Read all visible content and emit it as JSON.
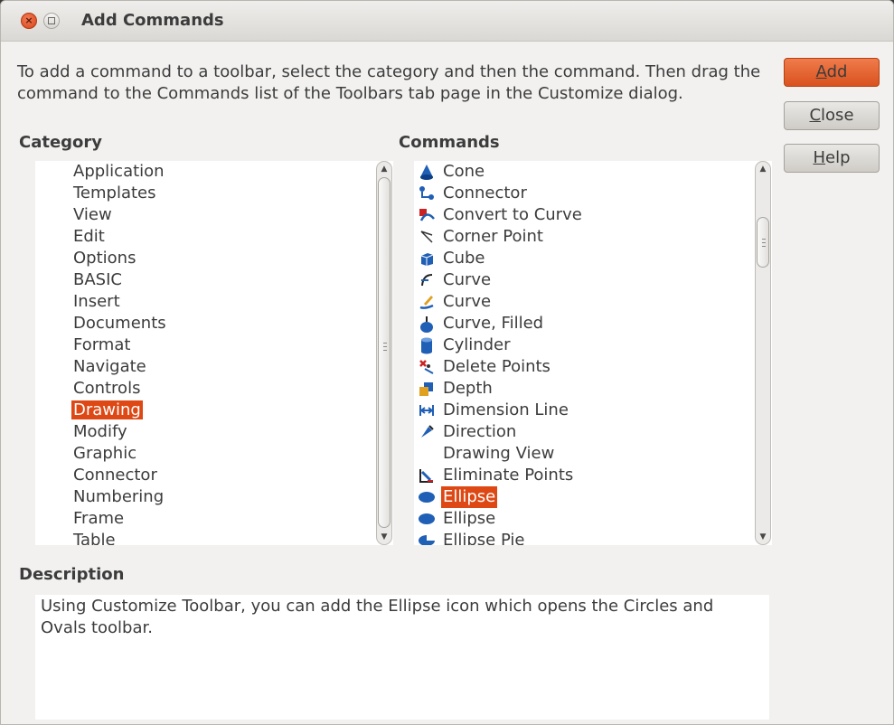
{
  "window": {
    "title": "Add Commands"
  },
  "intro": "To add a command to a toolbar, select the category and then the command. Then drag the command to the Commands list of the Toolbars tab page in the Customize dialog.",
  "buttons": {
    "add": {
      "label": "Add",
      "mnemonic": "A",
      "rest": "dd"
    },
    "close": {
      "label": "Close",
      "mnemonic": "C",
      "rest": "lose"
    },
    "help": {
      "label": "Help",
      "mnemonic": "H",
      "rest": "elp"
    }
  },
  "category": {
    "label": "Category",
    "items": [
      "Application",
      "Templates",
      "View",
      "Edit",
      "Options",
      "BASIC",
      "Insert",
      "Documents",
      "Format",
      "Navigate",
      "Controls",
      "Drawing",
      "Modify",
      "Graphic",
      "Connector",
      "Numbering",
      "Frame",
      "Table"
    ],
    "selected": "Drawing"
  },
  "commands": {
    "label": "Commands",
    "items": [
      {
        "label": "Cone",
        "icon": "cone-icon"
      },
      {
        "label": "Connector",
        "icon": "connector-icon"
      },
      {
        "label": "Convert to Curve",
        "icon": "convert-to-curve-icon"
      },
      {
        "label": "Corner Point",
        "icon": "corner-point-icon"
      },
      {
        "label": "Cube",
        "icon": "cube-icon"
      },
      {
        "label": "Curve",
        "icon": "curve-icon"
      },
      {
        "label": "Curve",
        "icon": "freeform-curve-icon"
      },
      {
        "label": "Curve, Filled",
        "icon": "curve-filled-icon"
      },
      {
        "label": "Cylinder",
        "icon": "cylinder-icon"
      },
      {
        "label": "Delete Points",
        "icon": "delete-points-icon"
      },
      {
        "label": "Depth",
        "icon": "depth-icon"
      },
      {
        "label": "Dimension Line",
        "icon": "dimension-line-icon"
      },
      {
        "label": "Direction",
        "icon": "direction-icon"
      },
      {
        "label": "Drawing View",
        "icon": ""
      },
      {
        "label": "Eliminate Points",
        "icon": "eliminate-points-icon"
      },
      {
        "label": "Ellipse",
        "icon": "ellipse-icon"
      },
      {
        "label": "Ellipse",
        "icon": "ellipse-icon"
      },
      {
        "label": "Ellipse Pie",
        "icon": "ellipse-pie-icon"
      }
    ],
    "selected_index": 15
  },
  "description": {
    "label": "Description",
    "text": "Using Customize Toolbar, you can add the Ellipse icon which opens the Circles and Ovals toolbar."
  },
  "colors": {
    "accent": "#dd4814",
    "window_bg": "#f2f1f0",
    "icon_blue": "#1f5fb5"
  }
}
